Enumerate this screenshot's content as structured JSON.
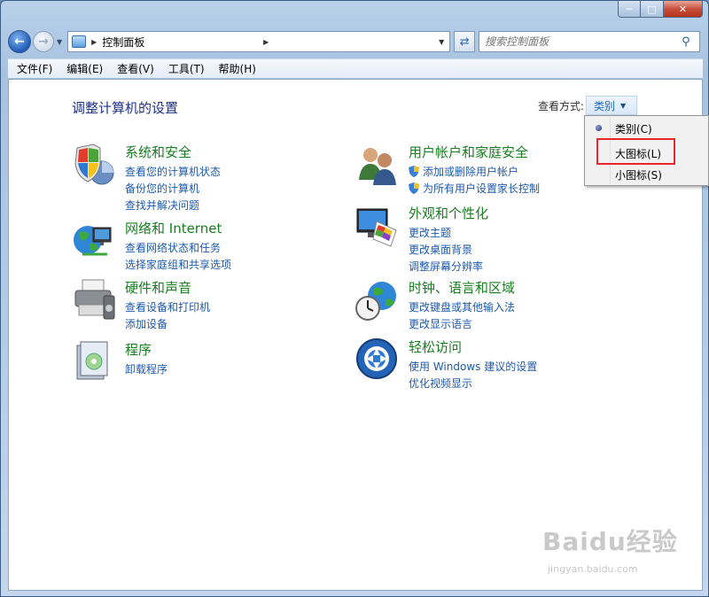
{
  "address": {
    "path": "控制面板"
  },
  "search": {
    "placeholder": "搜索控制面板"
  },
  "menu": [
    "文件(F)",
    "编辑(E)",
    "查看(V)",
    "工具(T)",
    "帮助(H)"
  ],
  "page": {
    "title": "调整计算机的设置",
    "view_by_label": "查看方式:",
    "view_by_value": "类别"
  },
  "categories": [
    {
      "title": "系统和安全",
      "icon": "shield-system-icon",
      "links": [
        "查看您的计算机状态",
        "备份您的计算机",
        "查找并解决问题"
      ]
    },
    {
      "title": "用户帐户和家庭安全",
      "icon": "users-icon",
      "links": [
        "添加或删除用户帐户",
        "为所有用户设置家长控制"
      ]
    },
    {
      "title": "网络和 Internet",
      "icon": "network-globe-icon",
      "links": [
        "查看网络状态和任务",
        "选择家庭组和共享选项"
      ]
    },
    {
      "title": "外观和个性化",
      "icon": "monitor-palette-icon",
      "links": [
        "更改主题",
        "更改桌面背景",
        "调整屏幕分辨率"
      ]
    },
    {
      "title": "硬件和声音",
      "icon": "printer-icon",
      "links": [
        "查看设备和打印机",
        "添加设备"
      ]
    },
    {
      "title": "时钟、语言和区域",
      "icon": "clock-globe-icon",
      "links": [
        "更改键盘或其他输入法",
        "更改显示语言"
      ]
    },
    {
      "title": "程序",
      "icon": "programs-box-icon",
      "links": [
        "卸载程序"
      ]
    },
    {
      "title": "轻松访问",
      "icon": "ease-of-access-icon",
      "links": [
        "使用 Windows 建议的设置",
        "优化视频显示"
      ]
    }
  ],
  "dropdown": {
    "items": [
      "类别(C)",
      "大图标(L)",
      "小图标(S)"
    ],
    "selected": 0,
    "highlighted": 1
  },
  "watermark": {
    "text": "Baidu经验",
    "sub": "jingyan.baidu.com"
  },
  "colors": {
    "category_title": "#187e21",
    "link": "#1d5aab",
    "page_title": "#1e3287",
    "highlight_box": "#e8262b"
  }
}
